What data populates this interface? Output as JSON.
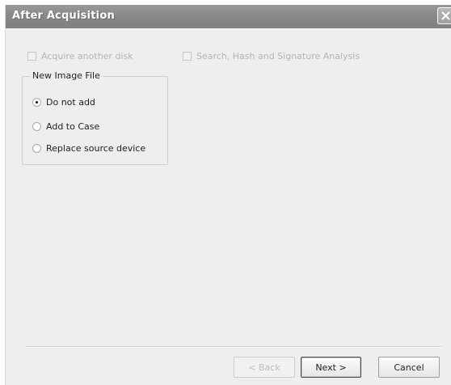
{
  "window": {
    "title": "After Acquisition"
  },
  "options": {
    "acquire_another_disk": {
      "label": "Acquire another disk",
      "checked": false,
      "enabled": false
    },
    "search_hash_signature": {
      "label": "Search, Hash and Signature Analysis",
      "checked": false,
      "enabled": false
    }
  },
  "new_image_file": {
    "legend": "New Image File",
    "options": [
      {
        "label": "Do not add",
        "selected": true
      },
      {
        "label": "Add to Case",
        "selected": false
      },
      {
        "label": "Replace source device",
        "selected": false
      }
    ]
  },
  "buttons": {
    "back": {
      "label": "< Back",
      "enabled": false
    },
    "next": {
      "label": "Next >",
      "enabled": true
    },
    "cancel": {
      "label": "Cancel",
      "enabled": true
    }
  },
  "icons": {
    "close": "close-icon"
  },
  "colors": {
    "titlebar": "#8a8a8a",
    "window_bg": "#eeeeee",
    "disabled_text": "#b4b4b4"
  }
}
